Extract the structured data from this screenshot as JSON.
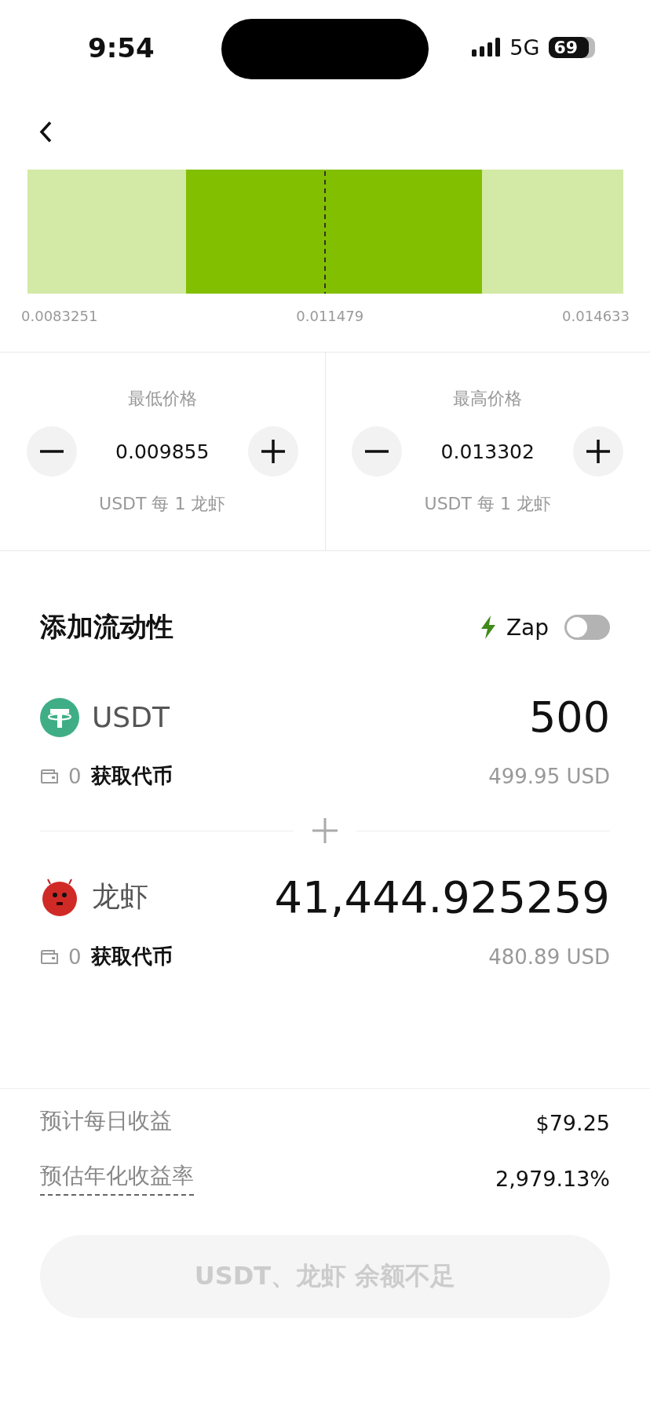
{
  "status_bar": {
    "time": "9:54",
    "network": "5G",
    "battery": "69"
  },
  "range_chart": {
    "labels": [
      "0.0083251",
      "0.011479",
      "0.014633"
    ]
  },
  "price_panels": [
    {
      "label": "最低价格",
      "value": "0.009855",
      "unit": "USDT 每 1 龙虾"
    },
    {
      "label": "最高价格",
      "value": "0.013302",
      "unit": "USDT 每 1 龙虾"
    }
  ],
  "add_liquidity": {
    "title": "添加流动性",
    "zap": {
      "label": "Zap",
      "on": false
    }
  },
  "tokens": [
    {
      "kind": "usdt",
      "symbol": "USDT",
      "amount": "500",
      "balance": "0",
      "get_link": "获取代币",
      "usd_value": "499.95 USD"
    },
    {
      "kind": "meme",
      "symbol": "龙虾",
      "amount": "41,444.925259",
      "balance": "0",
      "get_link": "获取代币",
      "usd_value": "480.89 USD"
    }
  ],
  "estimates": [
    {
      "label": "预计每日收益",
      "value": "$79.25",
      "dashed": false
    },
    {
      "label": "预估年化收益率",
      "value": "2,979.13%",
      "dashed": true
    }
  ],
  "submit_button": {
    "label": "USDT、龙虾 余额不足",
    "disabled": true
  }
}
